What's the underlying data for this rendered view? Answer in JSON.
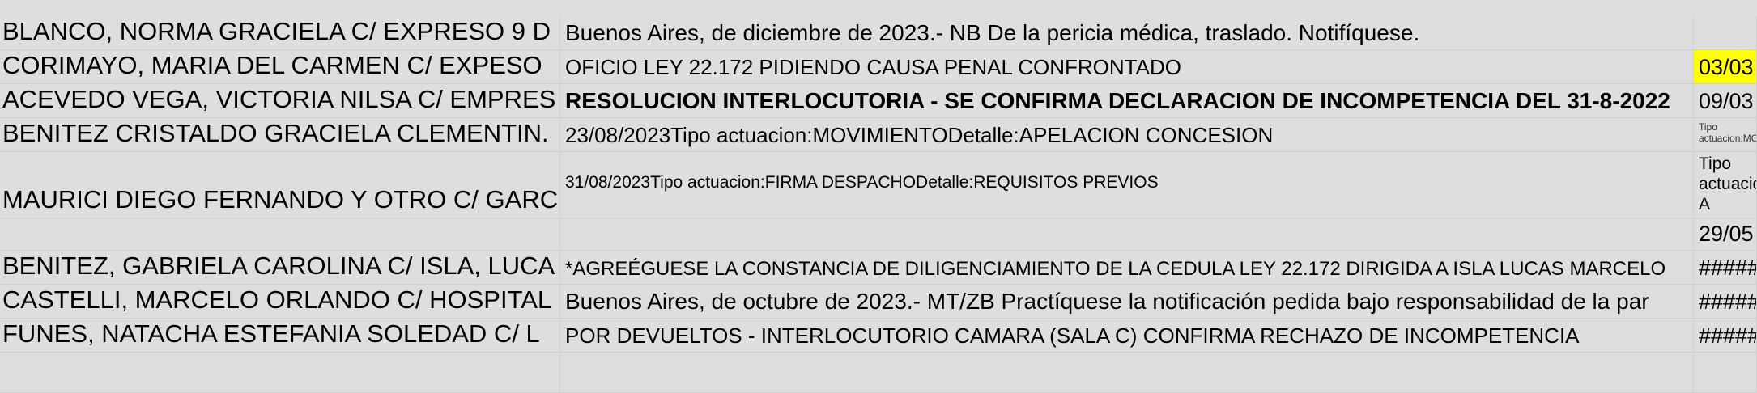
{
  "rows": [
    {
      "name": "BLANCO, NORMA GRACIELA C/ EXPRESO 9 D",
      "detail": "Buenos Aires, de diciembre de 2023.- NB De la pericia médica, traslado. Notifíquese.",
      "date": ""
    },
    {
      "name": "CORIMAYO, MARIA DEL CARMEN C/ EXPESO",
      "detail": "OFICIO LEY 22.172 PIDIENDO CAUSA PENAL CONFRONTADO",
      "date": "03/03"
    },
    {
      "name": "ACEVEDO VEGA, VICTORIA NILSA C/ EMPRES",
      "detail": "RESOLUCION INTERLOCUTORIA - SE CONFIRMA DECLARACION DE INCOMPETENCIA DEL 31-8-2022",
      "date": "09/03"
    },
    {
      "name": "BENITEZ CRISTALDO GRACIELA CLEMENTIN.",
      "detail": "23/08/2023Tipo actuacion:MOVIMIENTODetalle:APELACION CONCESION",
      "date": "Tipo actuacion:MO"
    },
    {
      "name": "MAURICI DIEGO FERNANDO Y OTRO C/ GARC",
      "detail": "31/08/2023Tipo actuacion:FIRMA DESPACHODetalle:REQUISITOS PREVIOS",
      "date": "Tipo actuacio A DESP"
    },
    {
      "name": "",
      "detail": "",
      "date": "29/05"
    },
    {
      "name": "BENITEZ, GABRIELA CAROLINA C/ ISLA, LUCA",
      "detail": "*AGREÉGUESE LA CONSTANCIA DE DILIGENCIAMIENTO DE LA CEDULA LEY 22.172 DIRIGIDA A ISLA LUCAS MARCELO",
      "date": "#####"
    },
    {
      "name": "CASTELLI, MARCELO ORLANDO C/ HOSPITAL",
      "detail": "Buenos Aires, de octubre de 2023.- MT/ZB Practíquese la notificación pedida bajo responsabilidad de la par",
      "date": "#####"
    },
    {
      "name": "FUNES, NATACHA ESTEFANIA SOLEDAD C/ L",
      "detail": "POR DEVUELTOS - INTERLOCUTORIO CAMARA (SALA C) CONFIRMA RECHAZO DE INCOMPETENCIA",
      "date": "#####"
    }
  ],
  "colors": {
    "highlight": "#ffff00",
    "background": "#dedede",
    "grid": "#cfcfcf"
  }
}
